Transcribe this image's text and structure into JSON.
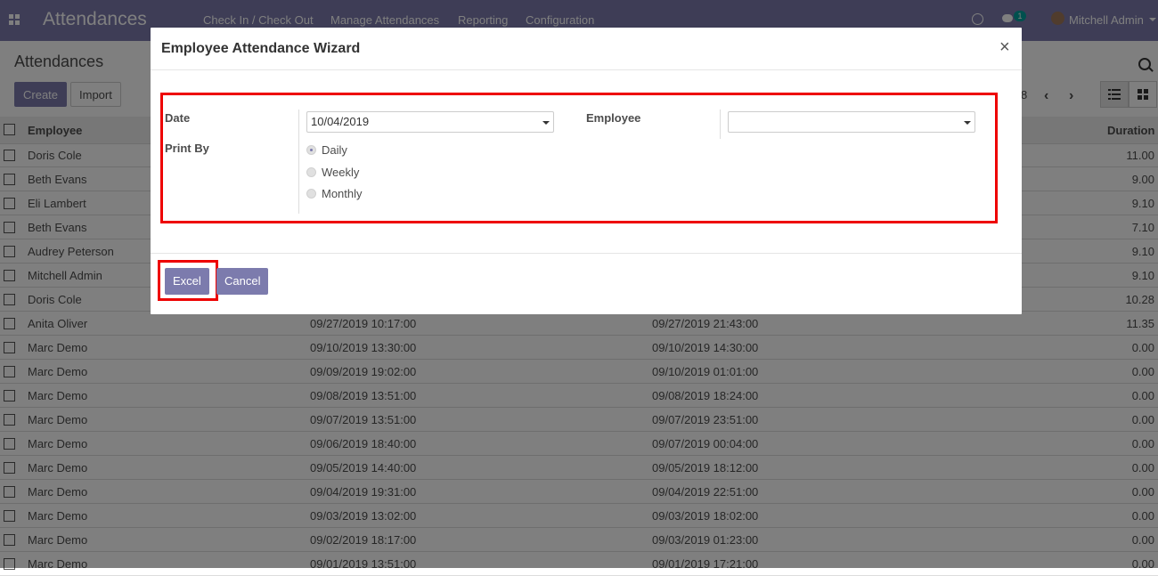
{
  "app": {
    "title": "Attendances",
    "menu": [
      "Check In / Check Out",
      "Manage Attendances",
      "Reporting",
      "Configuration"
    ],
    "user": "Mitchell Admin",
    "chat_badge": "1"
  },
  "control_panel": {
    "breadcrumb": "Attendances",
    "create_label": "Create",
    "import_label": "Import",
    "pager_partial": "8"
  },
  "list": {
    "headers": {
      "employee": "Employee",
      "duration": "Duration"
    },
    "rows": [
      {
        "employee": "Doris Cole",
        "check_in": "",
        "check_out": "",
        "duration": "11.00"
      },
      {
        "employee": "Beth Evans",
        "check_in": "",
        "check_out": "",
        "duration": "9.00"
      },
      {
        "employee": "Eli Lambert",
        "check_in": "",
        "check_out": "",
        "duration": "9.10"
      },
      {
        "employee": "Beth Evans",
        "check_in": "",
        "check_out": "",
        "duration": "7.10"
      },
      {
        "employee": "Audrey Peterson",
        "check_in": "",
        "check_out": "",
        "duration": "9.10"
      },
      {
        "employee": "Mitchell Admin",
        "check_in": "",
        "check_out": "",
        "duration": "9.10"
      },
      {
        "employee": "Doris Cole",
        "check_in": "",
        "check_out": "",
        "duration": "10.28"
      },
      {
        "employee": "Anita Oliver",
        "check_in": "09/27/2019 10:17:00",
        "check_out": "09/27/2019 21:43:00",
        "duration": "11.35"
      },
      {
        "employee": "Marc Demo",
        "check_in": "09/10/2019 13:30:00",
        "check_out": "09/10/2019 14:30:00",
        "duration": "0.00"
      },
      {
        "employee": "Marc Demo",
        "check_in": "09/09/2019 19:02:00",
        "check_out": "09/10/2019 01:01:00",
        "duration": "0.00"
      },
      {
        "employee": "Marc Demo",
        "check_in": "09/08/2019 13:51:00",
        "check_out": "09/08/2019 18:24:00",
        "duration": "0.00"
      },
      {
        "employee": "Marc Demo",
        "check_in": "09/07/2019 13:51:00",
        "check_out": "09/07/2019 23:51:00",
        "duration": "0.00"
      },
      {
        "employee": "Marc Demo",
        "check_in": "09/06/2019 18:40:00",
        "check_out": "09/07/2019 00:04:00",
        "duration": "0.00"
      },
      {
        "employee": "Marc Demo",
        "check_in": "09/05/2019 14:40:00",
        "check_out": "09/05/2019 18:12:00",
        "duration": "0.00"
      },
      {
        "employee": "Marc Demo",
        "check_in": "09/04/2019 19:31:00",
        "check_out": "09/04/2019 22:51:00",
        "duration": "0.00"
      },
      {
        "employee": "Marc Demo",
        "check_in": "09/03/2019 13:02:00",
        "check_out": "09/03/2019 18:02:00",
        "duration": "0.00"
      },
      {
        "employee": "Marc Demo",
        "check_in": "09/02/2019 18:17:00",
        "check_out": "09/03/2019 01:23:00",
        "duration": "0.00"
      },
      {
        "employee": "Marc Demo",
        "check_in": "09/01/2019 13:51:00",
        "check_out": "09/01/2019 17:21:00",
        "duration": "0.00"
      }
    ]
  },
  "modal": {
    "title": "Employee Attendance Wizard",
    "close_glyph": "×",
    "date_label": "Date",
    "date_value": "10/04/2019",
    "employee_label": "Employee",
    "employee_value": "",
    "print_by_label": "Print By",
    "print_by_options": [
      {
        "label": "Daily",
        "checked": true
      },
      {
        "label": "Weekly",
        "checked": false
      },
      {
        "label": "Monthly",
        "checked": false
      }
    ],
    "excel_label": "Excel",
    "cancel_label": "Cancel",
    "highlight_color": "#ee0000"
  },
  "colors": {
    "brand": "#7c7bad",
    "badge": "#00a09d"
  }
}
